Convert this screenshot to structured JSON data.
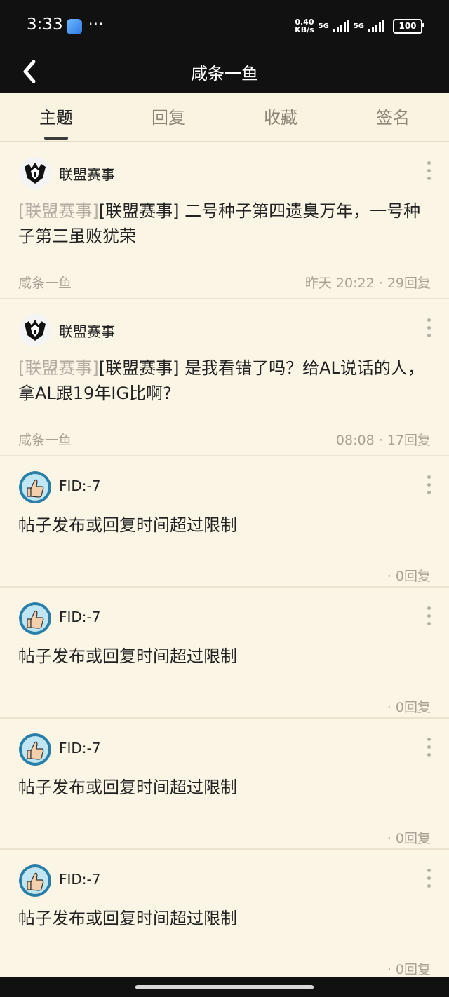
{
  "status_bar": {
    "time": "3:33",
    "dots": "···",
    "net_speed_value": "0.40",
    "net_speed_unit": "KB/s",
    "net1": "5G",
    "net2": "5G",
    "battery": "100"
  },
  "header": {
    "back_icon": "chevron-left-icon",
    "title": "咸条一鱼"
  },
  "tabs": [
    {
      "label": "主题",
      "active": true
    },
    {
      "label": "回复",
      "active": false
    },
    {
      "label": "收藏",
      "active": false
    },
    {
      "label": "签名",
      "active": false
    }
  ],
  "posts": [
    {
      "author": "联盟赛事",
      "tag": "[联盟赛事]",
      "text": "[联盟赛事] 二号种子第四遗臭万年，一号种子第三虽败犹荣",
      "user": "咸条一鱼",
      "time": "昨天  20:22",
      "replies": "· 29回复"
    },
    {
      "author": "联盟赛事",
      "tag": "[联盟赛事]",
      "text": "[联盟赛事] 是我看错了吗？给AL说话的人，拿AL跟19年IG比啊?",
      "user": "咸条一鱼",
      "time": "08:08",
      "replies": "· 17回复"
    },
    {
      "author": "FID:-7",
      "text": "帖子发布或回复时间超过限制",
      "replies": "· 0回复"
    },
    {
      "author": "FID:-7",
      "text": "帖子发布或回复时间超过限制",
      "replies": "· 0回复"
    },
    {
      "author": "FID:-7",
      "text": "帖子发布或回复时间超过限制",
      "replies": "· 0回复"
    },
    {
      "author": "FID:-7",
      "text": "帖子发布或回复时间超过限制",
      "replies": "· 0回复"
    }
  ]
}
